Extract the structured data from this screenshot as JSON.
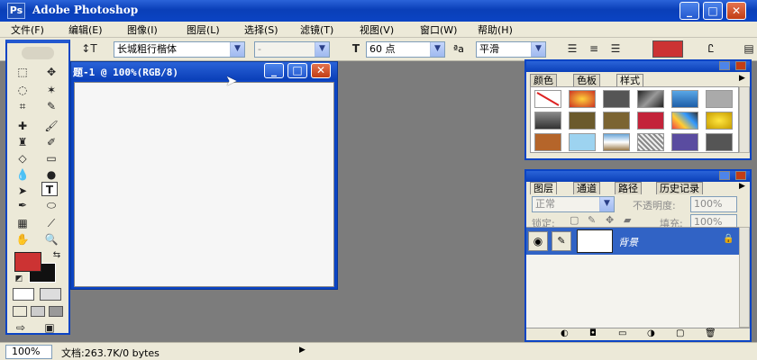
{
  "app": {
    "title": "Adobe Photoshop",
    "icon_letter": "Ps",
    "minimize_glyph": "_",
    "maximize_glyph": "□",
    "close_glyph": "✕"
  },
  "menu": [
    "文件(F)",
    "编辑(E)",
    "图像(I)",
    "图层(L)",
    "选择(S)",
    "滤镜(T)",
    "视图(V)",
    "窗口(W)",
    "帮助(H)"
  ],
  "options": {
    "font_family": "长城粗行楷体",
    "font_style": "-",
    "font_size": "60 点",
    "antialias_label": "ªa",
    "antialias": "平滑",
    "text_color": "#cc3333"
  },
  "tools": {
    "foreground_color": "#cc3333",
    "background_color": "#111111"
  },
  "document": {
    "title": "题-1 @ 100%(RGB/8)"
  },
  "styles_panel": {
    "tabs": [
      "颜色",
      "色板",
      "样式"
    ]
  },
  "layers_panel": {
    "tabs": [
      "图层",
      "通道",
      "路径",
      "历史记录"
    ],
    "blend_mode": "正常",
    "opacity_label": "不透明度:",
    "opacity": "100%",
    "lock_label": "锁定:",
    "fill_label": "填充:",
    "fill": "100%",
    "layer_name": "背景"
  },
  "status": {
    "zoom": "100%",
    "doc_info": "文档:263.7K/0 bytes",
    "arrow": "▶"
  }
}
